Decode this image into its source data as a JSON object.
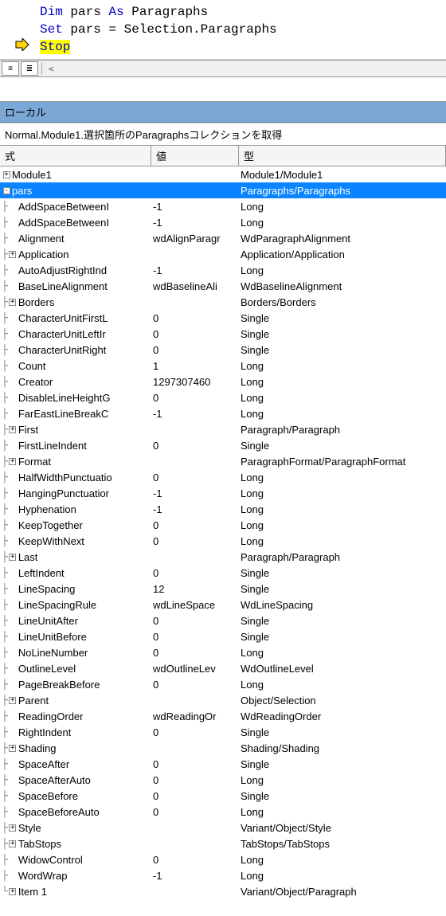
{
  "code": {
    "line1_dim": "Dim",
    "line1_var": " pars ",
    "line1_as": "As",
    "line1_type": " Paragraphs",
    "line2_set": "Set",
    "line2_rest": " pars = Selection.Paragraphs",
    "line3_stop": "Stop"
  },
  "panel": {
    "title": "ローカル",
    "context": "Normal.Module1.選択箇所のParagraphsコレクションを取得"
  },
  "headers": {
    "name": "式",
    "value": "値",
    "type": "型"
  },
  "rows": [
    {
      "depth": 0,
      "toggle": "plus",
      "name": "Module1",
      "value": "",
      "type": "Module1/Module1",
      "selected": false
    },
    {
      "depth": 0,
      "toggle": "minus",
      "name": "pars",
      "value": "",
      "type": "Paragraphs/Paragraphs",
      "selected": true
    },
    {
      "depth": 1,
      "toggle": "leaf",
      "name": "AddSpaceBetweenI",
      "value": "-1",
      "type": "Long"
    },
    {
      "depth": 1,
      "toggle": "leaf",
      "name": "AddSpaceBetweenI",
      "value": "-1",
      "type": "Long"
    },
    {
      "depth": 1,
      "toggle": "leaf",
      "name": "Alignment",
      "value": "wdAlignParagr",
      "type": "WdParagraphAlignment"
    },
    {
      "depth": 1,
      "toggle": "plus",
      "name": "Application",
      "value": "",
      "type": "Application/Application"
    },
    {
      "depth": 1,
      "toggle": "leaf",
      "name": "AutoAdjustRightInd",
      "value": "-1",
      "type": "Long"
    },
    {
      "depth": 1,
      "toggle": "leaf",
      "name": "BaseLineAlignment",
      "value": "wdBaselineAli",
      "type": "WdBaselineAlignment"
    },
    {
      "depth": 1,
      "toggle": "plus",
      "name": "Borders",
      "value": "",
      "type": "Borders/Borders"
    },
    {
      "depth": 1,
      "toggle": "leaf",
      "name": "CharacterUnitFirstL",
      "value": "0",
      "type": "Single"
    },
    {
      "depth": 1,
      "toggle": "leaf",
      "name": "CharacterUnitLeftIr",
      "value": "0",
      "type": "Single"
    },
    {
      "depth": 1,
      "toggle": "leaf",
      "name": "CharacterUnitRight",
      "value": "0",
      "type": "Single"
    },
    {
      "depth": 1,
      "toggle": "leaf",
      "name": "Count",
      "value": "1",
      "type": "Long"
    },
    {
      "depth": 1,
      "toggle": "leaf",
      "name": "Creator",
      "value": "1297307460",
      "type": "Long"
    },
    {
      "depth": 1,
      "toggle": "leaf",
      "name": "DisableLineHeightG",
      "value": "0",
      "type": "Long"
    },
    {
      "depth": 1,
      "toggle": "leaf",
      "name": "FarEastLineBreakC",
      "value": "-1",
      "type": "Long"
    },
    {
      "depth": 1,
      "toggle": "plus",
      "name": "First",
      "value": "",
      "type": "Paragraph/Paragraph"
    },
    {
      "depth": 1,
      "toggle": "leaf",
      "name": "FirstLineIndent",
      "value": "0",
      "type": "Single"
    },
    {
      "depth": 1,
      "toggle": "plus",
      "name": "Format",
      "value": "",
      "type": "ParagraphFormat/ParagraphFormat"
    },
    {
      "depth": 1,
      "toggle": "leaf",
      "name": "HalfWidthPunctuatio",
      "value": "0",
      "type": "Long"
    },
    {
      "depth": 1,
      "toggle": "leaf",
      "name": "HangingPunctuatior",
      "value": "-1",
      "type": "Long"
    },
    {
      "depth": 1,
      "toggle": "leaf",
      "name": "Hyphenation",
      "value": "-1",
      "type": "Long"
    },
    {
      "depth": 1,
      "toggle": "leaf",
      "name": "KeepTogether",
      "value": "0",
      "type": "Long"
    },
    {
      "depth": 1,
      "toggle": "leaf",
      "name": "KeepWithNext",
      "value": "0",
      "type": "Long"
    },
    {
      "depth": 1,
      "toggle": "plus",
      "name": "Last",
      "value": "",
      "type": "Paragraph/Paragraph"
    },
    {
      "depth": 1,
      "toggle": "leaf",
      "name": "LeftIndent",
      "value": "0",
      "type": "Single"
    },
    {
      "depth": 1,
      "toggle": "leaf",
      "name": "LineSpacing",
      "value": "12",
      "type": "Single"
    },
    {
      "depth": 1,
      "toggle": "leaf",
      "name": "LineSpacingRule",
      "value": "wdLineSpace",
      "type": "WdLineSpacing"
    },
    {
      "depth": 1,
      "toggle": "leaf",
      "name": "LineUnitAfter",
      "value": "0",
      "type": "Single"
    },
    {
      "depth": 1,
      "toggle": "leaf",
      "name": "LineUnitBefore",
      "value": "0",
      "type": "Single"
    },
    {
      "depth": 1,
      "toggle": "leaf",
      "name": "NoLineNumber",
      "value": "0",
      "type": "Long"
    },
    {
      "depth": 1,
      "toggle": "leaf",
      "name": "OutlineLevel",
      "value": "wdOutlineLev",
      "type": "WdOutlineLevel"
    },
    {
      "depth": 1,
      "toggle": "leaf",
      "name": "PageBreakBefore",
      "value": "0",
      "type": "Long"
    },
    {
      "depth": 1,
      "toggle": "plus",
      "name": "Parent",
      "value": "",
      "type": "Object/Selection"
    },
    {
      "depth": 1,
      "toggle": "leaf",
      "name": "ReadingOrder",
      "value": "wdReadingOr",
      "type": "WdReadingOrder"
    },
    {
      "depth": 1,
      "toggle": "leaf",
      "name": "RightIndent",
      "value": "0",
      "type": "Single"
    },
    {
      "depth": 1,
      "toggle": "plus",
      "name": "Shading",
      "value": "",
      "type": "Shading/Shading"
    },
    {
      "depth": 1,
      "toggle": "leaf",
      "name": "SpaceAfter",
      "value": "0",
      "type": "Single"
    },
    {
      "depth": 1,
      "toggle": "leaf",
      "name": "SpaceAfterAuto",
      "value": "0",
      "type": "Long"
    },
    {
      "depth": 1,
      "toggle": "leaf",
      "name": "SpaceBefore",
      "value": "0",
      "type": "Single"
    },
    {
      "depth": 1,
      "toggle": "leaf",
      "name": "SpaceBeforeAuto",
      "value": "0",
      "type": "Long"
    },
    {
      "depth": 1,
      "toggle": "plus",
      "name": "Style",
      "value": "",
      "type": "Variant/Object/Style"
    },
    {
      "depth": 1,
      "toggle": "plus",
      "name": "TabStops",
      "value": "",
      "type": "TabStops/TabStops"
    },
    {
      "depth": 1,
      "toggle": "leaf",
      "name": "WidowControl",
      "value": "0",
      "type": "Long"
    },
    {
      "depth": 1,
      "toggle": "leaf",
      "name": "WordWrap",
      "value": "-1",
      "type": "Long"
    },
    {
      "depth": 1,
      "toggle": "plus",
      "last": true,
      "name": "Item 1",
      "value": "",
      "type": "Variant/Object/Paragraph"
    }
  ]
}
